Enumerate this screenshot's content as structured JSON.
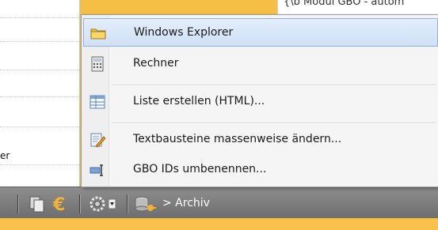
{
  "background": {
    "top_right_text": "{\\b Modul GBO - autom",
    "list_fragment": "er"
  },
  "menu": {
    "items": [
      {
        "label": "Windows Explorer",
        "icon": "folder-icon",
        "selected": true
      },
      {
        "label": "Rechner",
        "icon": "calculator-icon",
        "selected": false
      },
      {
        "label": "Liste erstellen (HTML)...",
        "icon": "table-icon",
        "selected": false
      },
      {
        "label": "Textbausteine massenweise ändern...",
        "icon": "edit-document-icon",
        "selected": false
      },
      {
        "label": "GBO IDs umbenennen...",
        "icon": "rename-icon",
        "selected": false
      }
    ]
  },
  "toolbar": {
    "archive_label": "> Archiv",
    "icons": [
      "copy-icon",
      "euro-icon",
      "settings-dropdown-icon",
      "database-icon"
    ]
  },
  "colors": {
    "accent": "#f7c14a",
    "selection": "#cfe0f6",
    "toolbar": "#7d7d7d"
  }
}
